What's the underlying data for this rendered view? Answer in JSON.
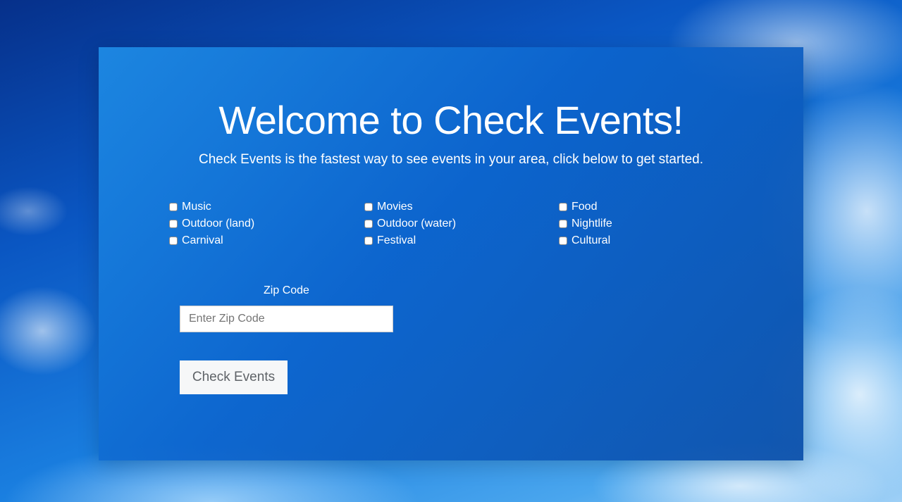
{
  "page": {
    "title": "Welcome to Check Events!",
    "subtitle": "Check Events is the fastest way to see events in your area, click below to get started."
  },
  "categories": [
    {
      "label": "Music",
      "checked": false
    },
    {
      "label": "Movies",
      "checked": false
    },
    {
      "label": "Food",
      "checked": false
    },
    {
      "label": "Outdoor (land)",
      "checked": false
    },
    {
      "label": "Outdoor (water)",
      "checked": false
    },
    {
      "label": "Nightlife",
      "checked": false
    },
    {
      "label": "Carnival",
      "checked": false
    },
    {
      "label": "Festival",
      "checked": false
    },
    {
      "label": "Cultural",
      "checked": false
    }
  ],
  "zip": {
    "label": "Zip Code",
    "placeholder": "Enter Zip Code",
    "value": ""
  },
  "submit": {
    "label": "Check Events"
  },
  "colors": {
    "panel": "#1470d2",
    "text": "#ffffff",
    "button_bg": "#f6f7f8",
    "button_text": "#5f6368"
  }
}
